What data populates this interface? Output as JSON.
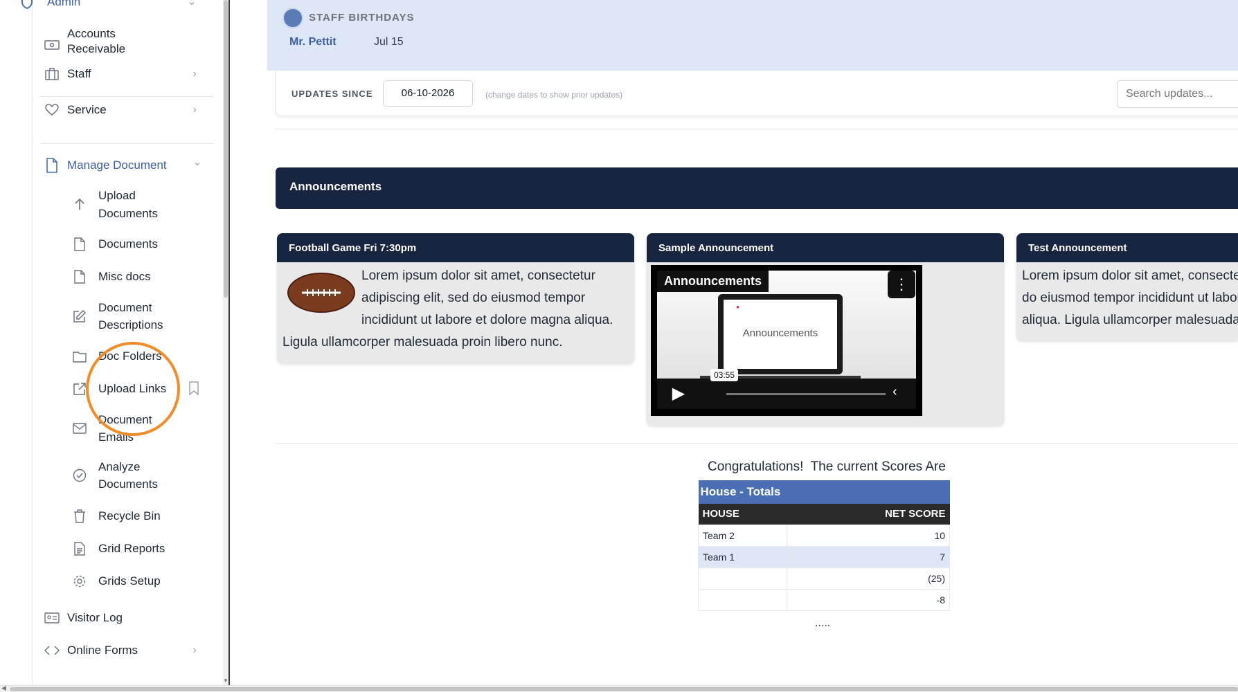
{
  "sidebar": {
    "admin": {
      "label": "Admin"
    },
    "items": [
      {
        "label": "Accounts\nReceivable",
        "icon": "cash-icon"
      },
      {
        "label": "Staff",
        "icon": "briefcase-icon"
      },
      {
        "label": "Service",
        "icon": "heart-icon"
      },
      {
        "label": "Manage Document",
        "icon": "file-icon"
      }
    ],
    "doc_items": [
      {
        "label": "Upload\nDocuments",
        "icon": "arrow-up-icon"
      },
      {
        "label": "Documents",
        "icon": "file-icon"
      },
      {
        "label": "Misc docs",
        "icon": "file-icon"
      },
      {
        "label": "Document\nDescriptions",
        "icon": "edit-icon"
      },
      {
        "label": "Doc Folders",
        "icon": "folder-icon"
      },
      {
        "label": "Upload Links",
        "icon": "external-link-icon"
      },
      {
        "label": "Document\nEmails",
        "icon": "mail-icon"
      },
      {
        "label": "Analyze\nDocuments",
        "icon": "check-circle-icon"
      },
      {
        "label": "Recycle Bin",
        "icon": "trash-icon"
      },
      {
        "label": "Grid Reports",
        "icon": "report-icon"
      },
      {
        "label": "Grids Setup",
        "icon": "gear-icon"
      }
    ],
    "bottom_items": [
      {
        "label": "Visitor Log",
        "icon": "id-card-icon"
      },
      {
        "label": "Online Forms",
        "icon": "code-icon"
      }
    ]
  },
  "birthdays": {
    "title": "STAFF BIRTHDAYS",
    "name": "Mr. Pettit",
    "date": "Jul 15"
  },
  "updates": {
    "label": "UPDATES SINCE",
    "date_value": "06-10-2026",
    "hint": "(change dates to show prior updates)",
    "search_placeholder": "Search updates..."
  },
  "announcements": {
    "title": "Announcements",
    "cards": [
      {
        "title": "Football Game Fri 7:30pm",
        "body": "Lorem ipsum dolor sit amet, consectetur adipiscing elit, sed do eiusmod tempor incididunt ut labore et dolore magna aliqua. Ligula ullamcorper malesuada proin libero nunc."
      },
      {
        "title": "Sample Announcement",
        "video_badge": "Announcements",
        "video_screen_text": "Announcements",
        "video_time": "03:55"
      },
      {
        "title": "Test Announcement",
        "body": "Lorem ipsum dolor sit amet, consectetur adipiscing elit, sed do eiusmod tempor incididunt ut labore et dolore magna aliqua. Ligula ullamcorper malesuada proin libero nunc."
      }
    ]
  },
  "scores": {
    "heading": "Congratulations!  The current Scores Are",
    "table_title": "House - Totals",
    "columns": [
      "HOUSE",
      "NET SCORE"
    ],
    "rows": [
      {
        "house": "Team 2",
        "score": "10"
      },
      {
        "house": "Team 1",
        "score": "7"
      },
      {
        "house": "",
        "score": "(25)"
      },
      {
        "house": "",
        "score": "-8"
      }
    ],
    "more": "....."
  },
  "colors": {
    "navy": "#182541",
    "accent_blue": "#4a6fb5",
    "light_blue": "#dde7f6",
    "highlight_ring": "#f28c28"
  }
}
